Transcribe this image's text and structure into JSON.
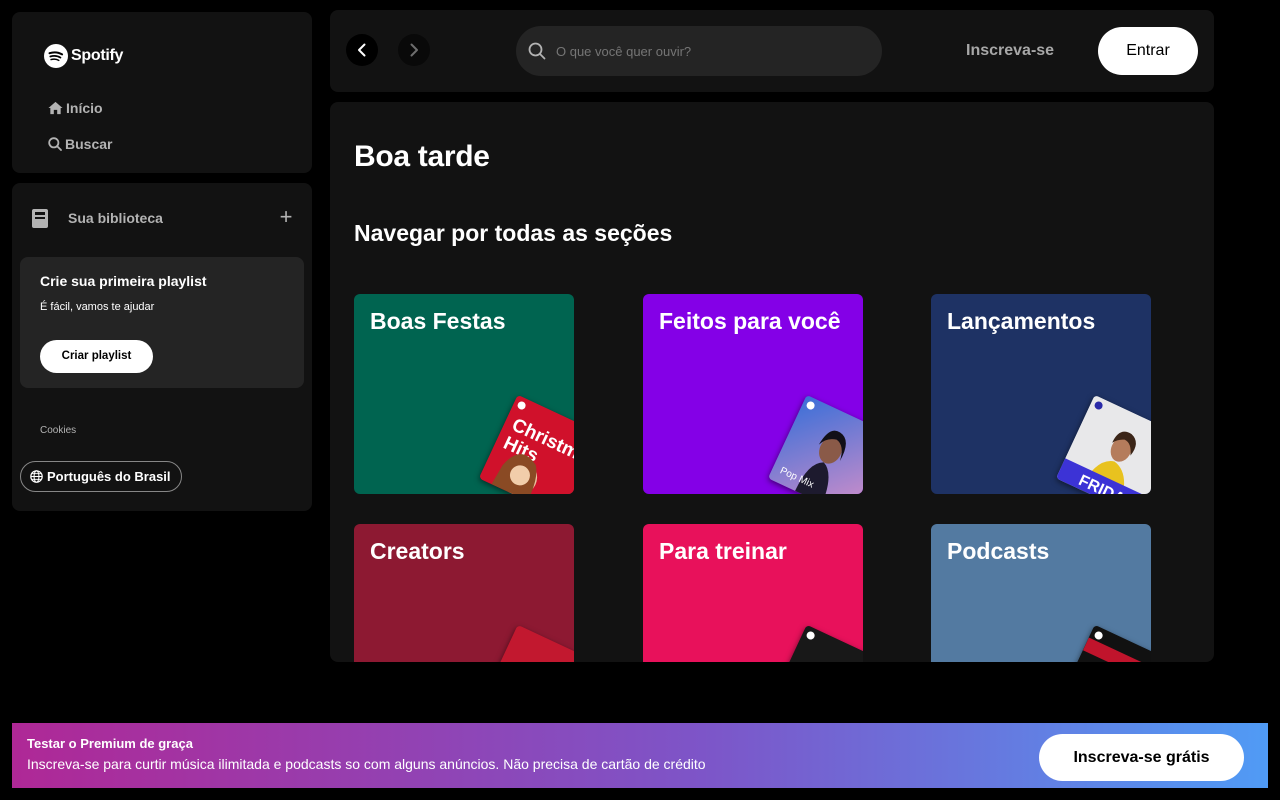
{
  "brand": {
    "name": "Spotify"
  },
  "nav": {
    "home": "Início",
    "search": "Buscar"
  },
  "library": {
    "title": "Sua biblioteca",
    "promo_title": "Crie sua primeira playlist",
    "promo_sub": "É fácil, vamos te ajudar",
    "create_button": "Criar playlist",
    "cookies": "Cookies",
    "language": "Português do Brasil"
  },
  "topbar": {
    "search_placeholder": "O que você quer ouvir?",
    "signup": "Inscreva-se",
    "login": "Entrar"
  },
  "main": {
    "greeting": "Boa tarde",
    "section_title": "Navegar por todas as seções",
    "cards": [
      {
        "title": "Boas Festas",
        "color": "#006450",
        "art_text": "Christmas Hits"
      },
      {
        "title": "Feitos para você",
        "color": "#8400e7",
        "art_text": "Pop Mix"
      },
      {
        "title": "Lançamentos",
        "color": "#1e3264",
        "art_text": "FRIDAY"
      },
      {
        "title": "Creators",
        "color": "#8d1932",
        "art_text": ""
      },
      {
        "title": "Para treinar",
        "color": "#e8115b",
        "art_text": ""
      },
      {
        "title": "Podcasts",
        "color": "#537aa1",
        "art_text": ""
      }
    ]
  },
  "banner": {
    "title": "Testar o Premium de graça",
    "text": "Inscreva-se para curtir música ilimitada e podcasts so com alguns anúncios. Não precisa de cartão de crédito",
    "button": "Inscreva-se grátis"
  }
}
